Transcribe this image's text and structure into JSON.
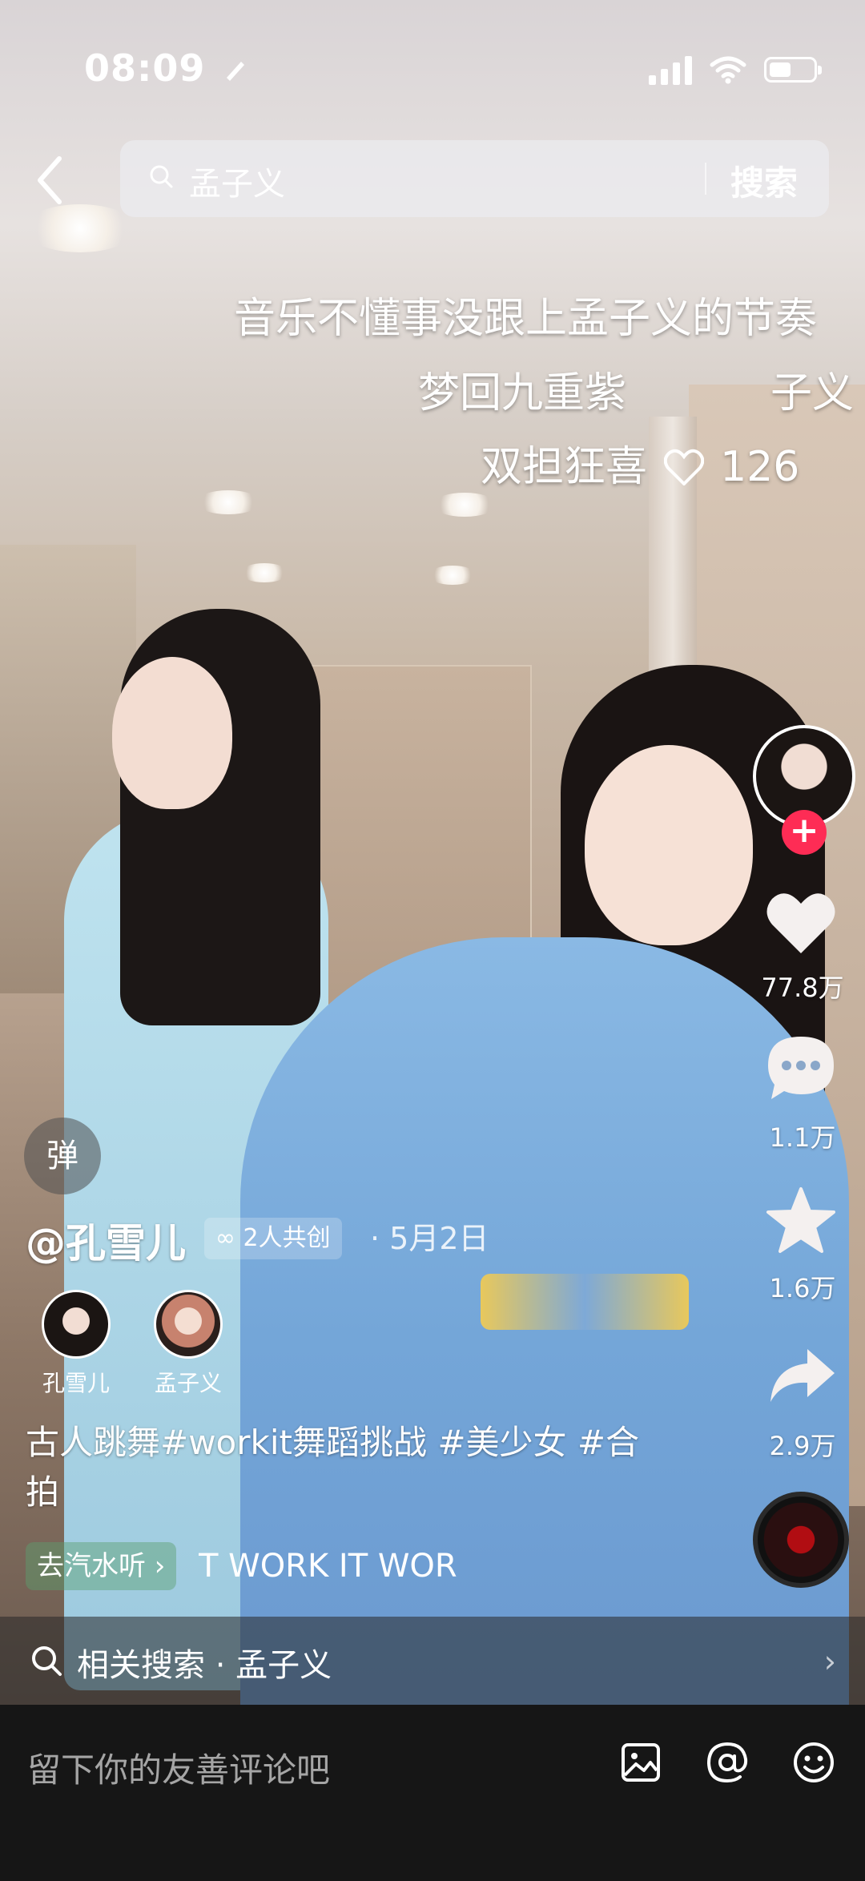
{
  "status_bar": {
    "time": "08:09"
  },
  "search": {
    "query": "孟子义",
    "button_label": "搜索"
  },
  "danmaku": [
    {
      "text": "音乐不懂事没跟上孟子义的节奏"
    },
    {
      "text": "梦回九重紫"
    },
    {
      "text": "子义"
    },
    {
      "text": "双担狂喜",
      "likes": "126"
    }
  ],
  "right_rail": {
    "like_count": "77.8万",
    "comment_count": "1.1万",
    "favorite_count": "1.6万",
    "share_count": "2.9万"
  },
  "post": {
    "danmu_toggle": "弹",
    "author": "@孔雪儿",
    "collab_label": "2人共创",
    "date": "· 5月2日",
    "collaborators": [
      {
        "name": "孔雪儿"
      },
      {
        "name": "孟子义"
      }
    ],
    "caption": "古人跳舞#workit舞蹈挑战 #美少女 #合拍",
    "music_chip": "去汽水听 ›",
    "music_title": "T   WORK IT   WOR"
  },
  "related_search": {
    "label": "相关搜索 · 孟子义"
  },
  "comment_bar": {
    "placeholder": "留下你的友善评论吧"
  },
  "colors": {
    "accent": "#fe2c55",
    "comment_bar_bg": "#161616"
  }
}
